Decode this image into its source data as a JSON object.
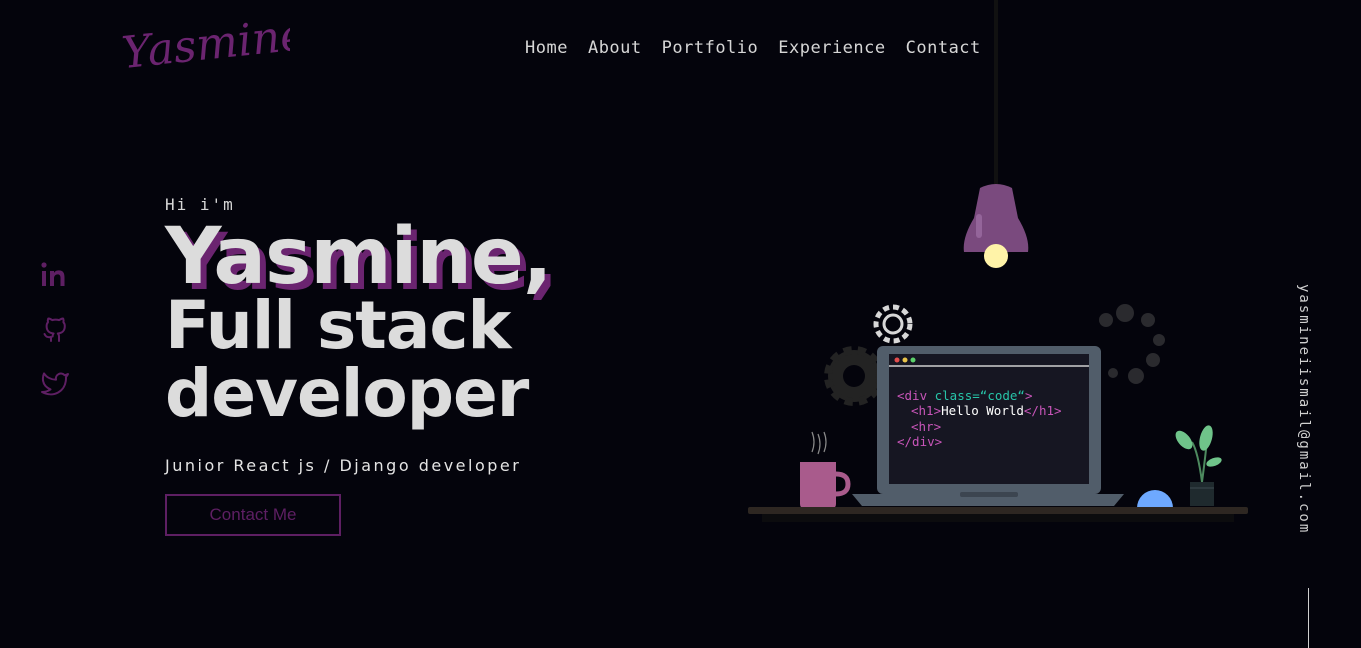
{
  "logo": {
    "text": "Yasmine"
  },
  "nav": {
    "items": [
      "Home",
      "About",
      "Portfolio",
      "Experience",
      "Contact"
    ]
  },
  "socials": {
    "icons": [
      "linkedin-icon",
      "github-icon",
      "twitter-icon"
    ]
  },
  "hero": {
    "greeting": "Hi i'm",
    "name": "Yasmine,",
    "role_line1": "Full stack",
    "role_line2": "developer",
    "subtitle": "Junior React js / Django developer",
    "cta_label": "Contact Me"
  },
  "email": "yasmineiismail@gmail.com",
  "code_snippet": {
    "line1_tag": "<div",
    "line1_attr": " class=“code“",
    "line1_end": ">",
    "line2_open": "<h1>",
    "line2_text": "Hello World",
    "line2_close": "</h1>",
    "line3": "<hr>",
    "line4": "</div>"
  },
  "colors": {
    "accent": "#6b2470",
    "background": "#04040c",
    "text": "#dcdcdc"
  }
}
